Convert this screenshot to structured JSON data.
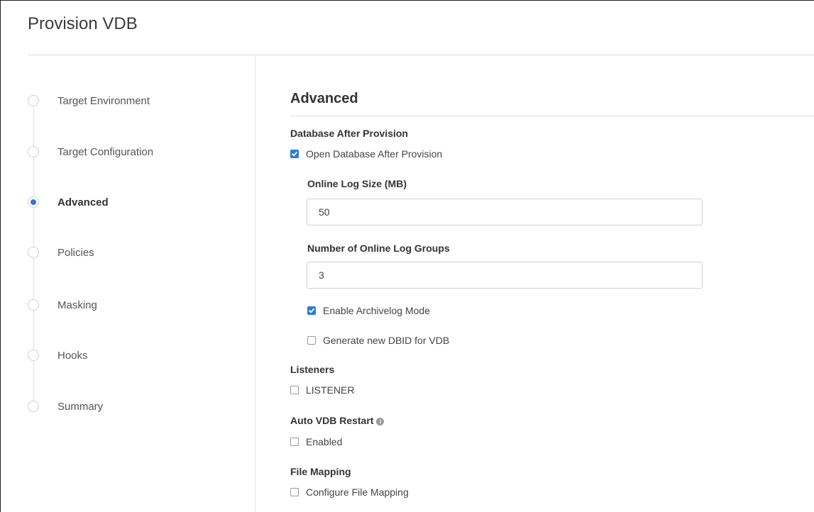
{
  "header": {
    "title": "Provision VDB"
  },
  "steps": [
    {
      "label": "Target Environment",
      "active": false
    },
    {
      "label": "Target Configuration",
      "active": false
    },
    {
      "label": "Advanced",
      "active": true
    },
    {
      "label": "Policies",
      "active": false
    },
    {
      "label": "Masking",
      "active": false
    },
    {
      "label": "Hooks",
      "active": false
    },
    {
      "label": "Summary",
      "active": false
    }
  ],
  "main": {
    "section_title": "Advanced",
    "db_after_provision": {
      "heading": "Database After Provision",
      "open_db_label": "Open Database After Provision",
      "open_db_checked": true
    },
    "online_log_size": {
      "label": "Online Log Size (MB)",
      "value": "50"
    },
    "online_log_groups": {
      "label": "Number of Online Log Groups",
      "value": "3"
    },
    "archivelog": {
      "label": "Enable Archivelog Mode",
      "checked": true
    },
    "new_dbid": {
      "label": "Generate new DBID for VDB",
      "checked": false
    },
    "listeners": {
      "heading": "Listeners",
      "items": [
        {
          "label": "LISTENER",
          "checked": false
        }
      ]
    },
    "auto_restart": {
      "heading": "Auto VDB Restart",
      "info_icon": "info-icon",
      "enabled_label": "Enabled",
      "checked": false
    },
    "file_mapping": {
      "heading": "File Mapping",
      "configure_label": "Configure File Mapping",
      "checked": false
    }
  },
  "colors": {
    "accent": "#2b7bd6",
    "divider": "#dddddd"
  }
}
